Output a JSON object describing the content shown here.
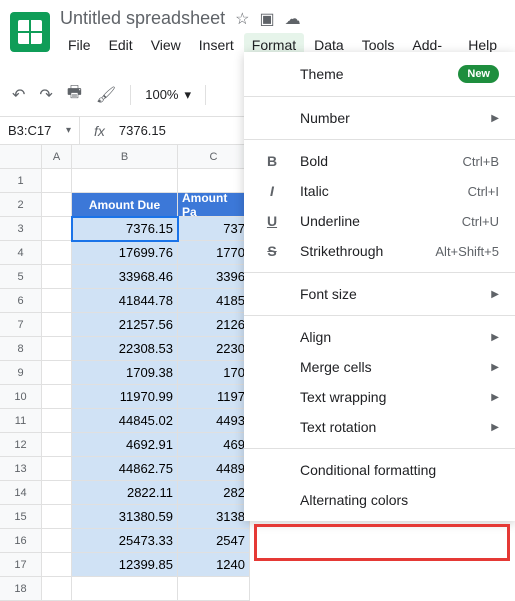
{
  "header": {
    "title": "Untitled spreadsheet"
  },
  "menubar": [
    "File",
    "Edit",
    "View",
    "Insert",
    "Format",
    "Data",
    "Tools",
    "Add-ons",
    "Help"
  ],
  "toolbar": {
    "zoom": "100%"
  },
  "formula": {
    "nameBox": "B3:C17",
    "value": "7376.15"
  },
  "columns": [
    "A",
    "B",
    "C"
  ],
  "tableHeaders": {
    "b": "Amount Due",
    "c": "Amount Pa"
  },
  "rows": [
    {
      "n": "1",
      "b": "",
      "c": ""
    },
    {
      "n": "2",
      "b": "",
      "c": ""
    },
    {
      "n": "3",
      "b": "7376.15",
      "c": "737"
    },
    {
      "n": "4",
      "b": "17699.76",
      "c": "1770"
    },
    {
      "n": "5",
      "b": "33968.46",
      "c": "3396"
    },
    {
      "n": "6",
      "b": "41844.78",
      "c": "4185"
    },
    {
      "n": "7",
      "b": "21257.56",
      "c": "2126"
    },
    {
      "n": "8",
      "b": "22308.53",
      "c": "2230"
    },
    {
      "n": "9",
      "b": "1709.38",
      "c": "170"
    },
    {
      "n": "10",
      "b": "11970.99",
      "c": "1197"
    },
    {
      "n": "11",
      "b": "44845.02",
      "c": "4493"
    },
    {
      "n": "12",
      "b": "4692.91",
      "c": "469"
    },
    {
      "n": "13",
      "b": "44862.75",
      "c": "4489"
    },
    {
      "n": "14",
      "b": "2822.11",
      "c": "282"
    },
    {
      "n": "15",
      "b": "31380.59",
      "c": "3138"
    },
    {
      "n": "16",
      "b": "25473.33",
      "c": "2547"
    },
    {
      "n": "17",
      "b": "12399.85",
      "c": "1240"
    },
    {
      "n": "18",
      "b": "",
      "c": ""
    }
  ],
  "dropdown": {
    "theme": "Theme",
    "newBadge": "New",
    "number": "Number",
    "bold": "Bold",
    "boldKey": "Ctrl+B",
    "italic": "Italic",
    "italicKey": "Ctrl+I",
    "underline": "Underline",
    "underlineKey": "Ctrl+U",
    "strike": "Strikethrough",
    "strikeKey": "Alt+Shift+5",
    "fontSize": "Font size",
    "align": "Align",
    "merge": "Merge cells",
    "wrap": "Text wrapping",
    "rotate": "Text rotation",
    "conditional": "Conditional formatting",
    "alternating": "Alternating colors"
  }
}
